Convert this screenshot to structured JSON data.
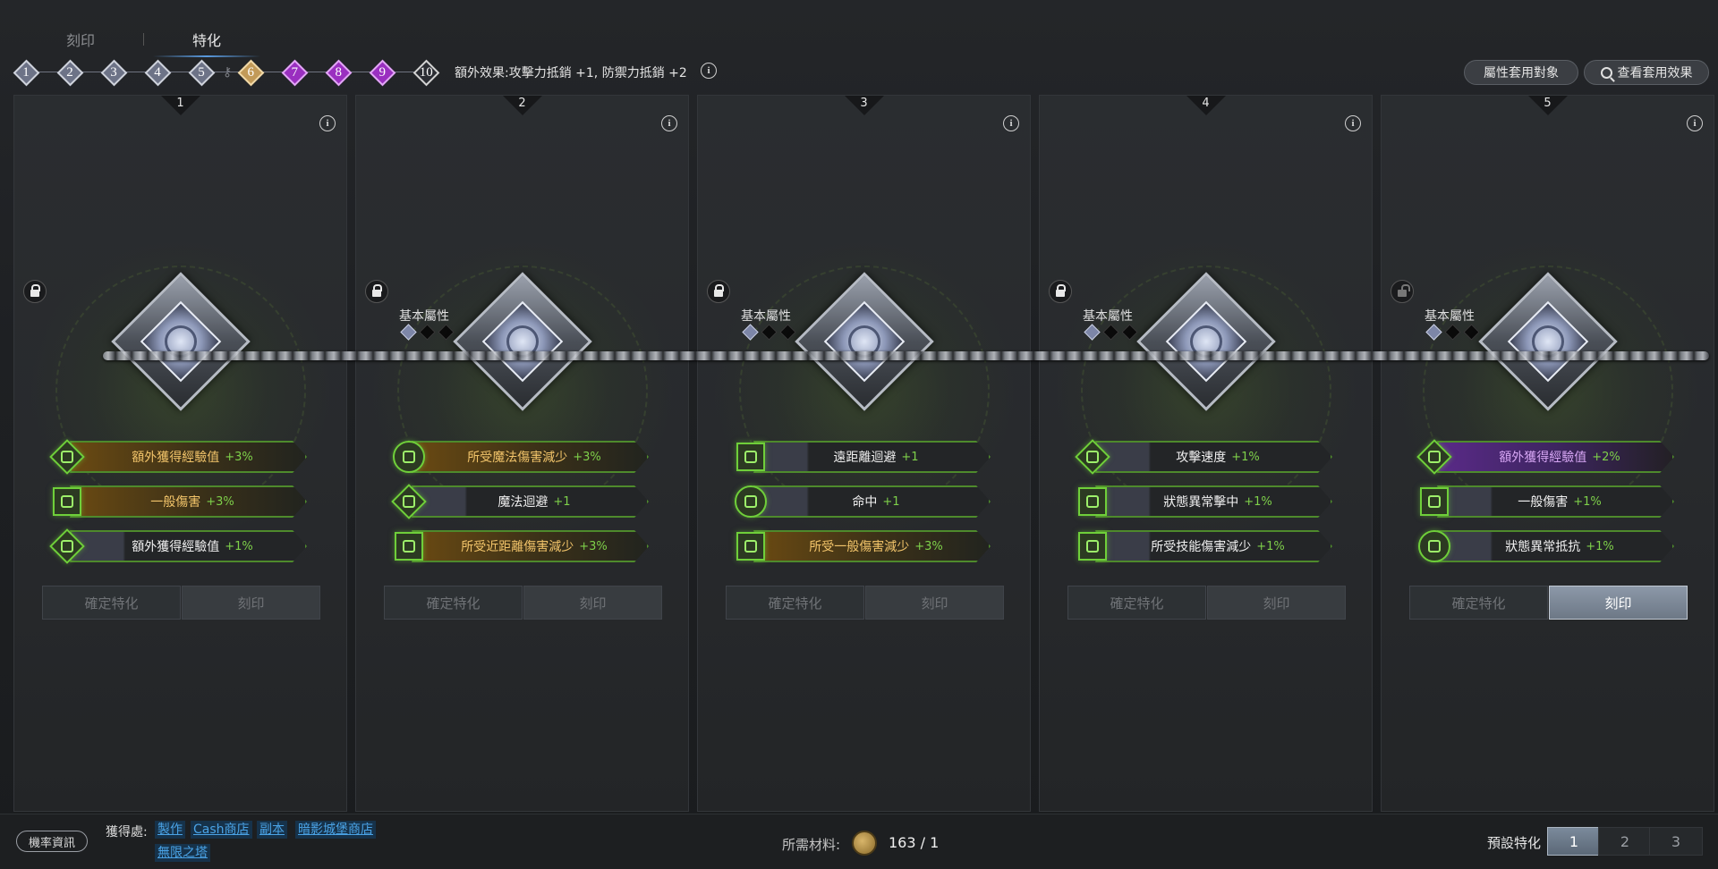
{
  "tabs": [
    {
      "label": "刻印",
      "active": false
    },
    {
      "label": "特化",
      "active": true
    }
  ],
  "levels": [
    {
      "n": "1",
      "tier": "silver"
    },
    {
      "n": "2",
      "tier": "silver"
    },
    {
      "n": "3",
      "tier": "silver"
    },
    {
      "n": "4",
      "tier": "silver"
    },
    {
      "n": "5",
      "tier": "silver"
    },
    {
      "n": "6",
      "tier": "gold"
    },
    {
      "n": "7",
      "tier": "purple"
    },
    {
      "n": "8",
      "tier": "purple"
    },
    {
      "n": "9",
      "tier": "purple"
    },
    {
      "n": "10",
      "tier": "last"
    }
  ],
  "extra_effect": "額外效果:攻擊力抵銷 +1, 防禦力抵銷 +2",
  "buttons": {
    "apply_targets": "屬性套用對象",
    "view_effects": "查看套用效果"
  },
  "panel_common": {
    "basic_attr": "基本屬性",
    "confirm": "確定特化",
    "engrave": "刻印",
    "info_glyph": "i"
  },
  "panels": [
    {
      "num": "1",
      "locked": true,
      "show_basic": false,
      "engrave_enabled": false,
      "options": [
        {
          "name": "額外獲得經驗值",
          "val": "+3%",
          "style": "gold",
          "icon": "diamond-rune-icon"
        },
        {
          "name": "一般傷害",
          "val": "+3%",
          "style": "gold",
          "icon": "helmet-square-icon"
        },
        {
          "name": "額外獲得經驗值",
          "val": "+1%",
          "style": "plain",
          "icon": "diamond-rune-icon"
        }
      ]
    },
    {
      "num": "2",
      "locked": true,
      "show_basic": true,
      "engrave_enabled": false,
      "options": [
        {
          "name": "所受魔法傷害減少",
          "val": "+3%",
          "style": "gold",
          "icon": "helmet-round-icon"
        },
        {
          "name": "魔法迴避",
          "val": "+1",
          "style": "plain",
          "icon": "diamond-rune-icon"
        },
        {
          "name": "所受近距離傷害減少",
          "val": "+3%",
          "style": "gold",
          "icon": "helmet-square-icon"
        }
      ]
    },
    {
      "num": "3",
      "locked": true,
      "show_basic": true,
      "engrave_enabled": false,
      "options": [
        {
          "name": "遠距離迴避",
          "val": "+1",
          "style": "plain",
          "icon": "helmet-square-icon"
        },
        {
          "name": "命中",
          "val": "+1",
          "style": "plain",
          "icon": "helmet-round-icon"
        },
        {
          "name": "所受一般傷害減少",
          "val": "+3%",
          "style": "gold",
          "icon": "helmet-square-icon"
        }
      ]
    },
    {
      "num": "4",
      "locked": true,
      "show_basic": true,
      "engrave_enabled": false,
      "options": [
        {
          "name": "攻擊速度",
          "val": "+1%",
          "style": "plain",
          "icon": "diamond-rune-icon"
        },
        {
          "name": "狀態異常擊中",
          "val": "+1%",
          "style": "plain",
          "icon": "helmet-square-icon"
        },
        {
          "name": "所受技能傷害減少",
          "val": "+1%",
          "style": "plain",
          "icon": "helmet-square-icon"
        }
      ]
    },
    {
      "num": "5",
      "locked": false,
      "show_basic": true,
      "engrave_enabled": true,
      "options": [
        {
          "name": "額外獲得經驗值",
          "val": "+2%",
          "style": "purple",
          "icon": "diamond-rune-icon"
        },
        {
          "name": "一般傷害",
          "val": "+1%",
          "style": "plain",
          "icon": "helmet-square-icon"
        },
        {
          "name": "狀態異常抵抗",
          "val": "+1%",
          "style": "plain",
          "icon": "helmet-round-icon"
        }
      ]
    }
  ],
  "bottom": {
    "probability": "機率資訊",
    "obtain_label": "獲得處:",
    "obtain_links": [
      "製作",
      "Cash商店",
      "副本",
      "暗影城堡商店",
      "無限之塔"
    ],
    "materials_label": "所需材料:",
    "materials_count": "163 / 1",
    "preset_label": "預設特化",
    "presets": [
      "1",
      "2",
      "3"
    ],
    "active_preset": "1"
  },
  "colors": {
    "accent_green": "#6fcf3a",
    "value_green": "#7ed04a",
    "gold_text": "#f2c46a",
    "purple_text": "#d7a6f4",
    "link_blue": "#4aa3e6"
  }
}
